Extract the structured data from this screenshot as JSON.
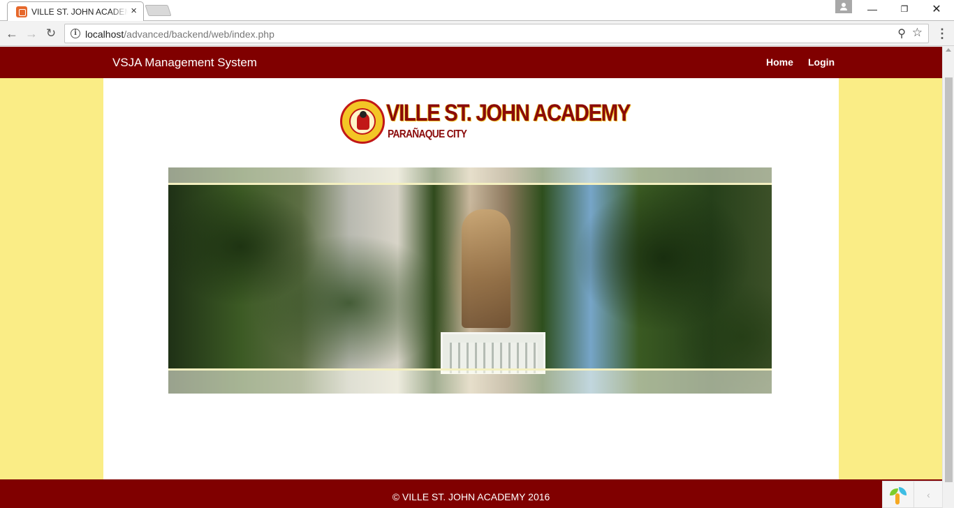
{
  "browser": {
    "tab_title": "VILLE ST. JOHN ACADEMY",
    "tab_close": "×",
    "url_host": "localhost",
    "url_path": "/advanced/backend/web/index.php",
    "info_glyph": "i",
    "back_glyph": "←",
    "forward_glyph": "→",
    "reload_glyph": "↻",
    "zoom_glyph": "⚲",
    "star_glyph": "☆",
    "menu_glyph": "⋮",
    "minimize_glyph": "—",
    "maximize_glyph": "❐",
    "close_glyph": "✕"
  },
  "navbar": {
    "brand": "VSJA Management System",
    "links": [
      "Home",
      "Login"
    ],
    "color": "#800000"
  },
  "logo": {
    "title": "VILLE ST. JOHN ACADEMY",
    "subtitle": "PARAÑAQUE CITY",
    "title_color": "#8a0a0a",
    "accent": "#f3c626"
  },
  "banner": {
    "description_icon": "school-building-photo"
  },
  "page": {
    "background": "#faed86"
  },
  "footer": {
    "text": "© VILLE ST. JOHN ACADEMY 2016",
    "color": "#800000"
  },
  "debug_toolbar": {
    "toggle_glyph": "‹"
  }
}
